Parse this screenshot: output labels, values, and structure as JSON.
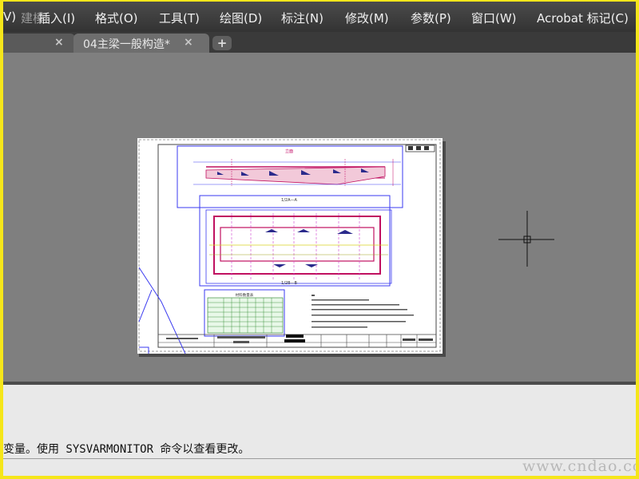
{
  "menubar": {
    "items": [
      {
        "label": "V)",
        "ghost": "建模"
      },
      {
        "label": "插入(I)"
      },
      {
        "label": "格式(O)"
      },
      {
        "label": "工具(T)"
      },
      {
        "label": "绘图(D)"
      },
      {
        "label": "标注(N)"
      },
      {
        "label": "修改(M)"
      },
      {
        "label": "参数(P)"
      },
      {
        "label": "窗口(W)"
      },
      {
        "label": "Acrobat 标记(C)"
      }
    ]
  },
  "tabs": {
    "previous": {
      "close": "×"
    },
    "active": {
      "label": "04主梁一般构造*",
      "close": "×"
    },
    "new_tab": "+"
  },
  "drawing": {
    "title_elevation": "立面",
    "section_label_1": "1/2A—A",
    "section_label_2": "1/2B—B",
    "table_title": "材料数量表"
  },
  "command": {
    "text": "变量。使用 SYSVARMONITOR 命令以查看更改。"
  },
  "watermark": "www.cndao.com"
}
